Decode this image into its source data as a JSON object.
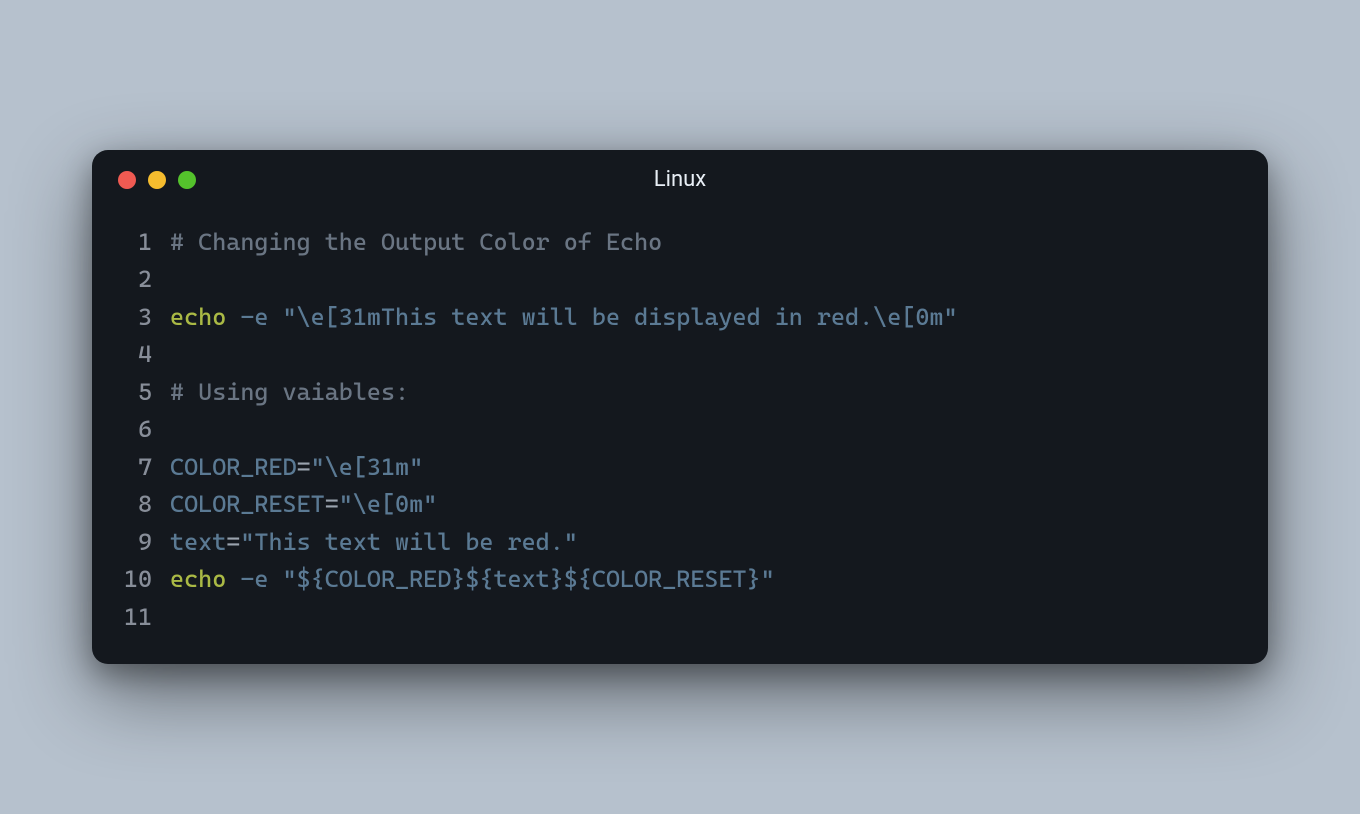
{
  "window": {
    "title": "Linux",
    "controls": {
      "close_color": "#ef5a52",
      "minimize_color": "#f5bc2e",
      "zoom_color": "#54c22c"
    }
  },
  "code": {
    "lines": [
      {
        "n": "1",
        "tokens": [
          {
            "cls": "tok-comment",
            "t": "# Changing the Output Color of Echo"
          }
        ]
      },
      {
        "n": "2",
        "tokens": []
      },
      {
        "n": "3",
        "tokens": [
          {
            "cls": "tok-builtin",
            "t": "echo"
          },
          {
            "cls": "",
            "t": " "
          },
          {
            "cls": "tok-flag",
            "t": "-e"
          },
          {
            "cls": "",
            "t": " "
          },
          {
            "cls": "tok-string",
            "t": "\"\\e[31mThis text will be displayed in red.\\e[0m\""
          }
        ]
      },
      {
        "n": "4",
        "tokens": []
      },
      {
        "n": "5",
        "tokens": [
          {
            "cls": "tok-comment",
            "t": "# Using vaiables:"
          }
        ]
      },
      {
        "n": "6",
        "tokens": []
      },
      {
        "n": "7",
        "tokens": [
          {
            "cls": "tok-var",
            "t": "COLOR_RED"
          },
          {
            "cls": "tok-op",
            "t": "="
          },
          {
            "cls": "tok-string",
            "t": "\"\\e[31m\""
          }
        ]
      },
      {
        "n": "8",
        "tokens": [
          {
            "cls": "tok-var",
            "t": "COLOR_RESET"
          },
          {
            "cls": "tok-op",
            "t": "="
          },
          {
            "cls": "tok-string",
            "t": "\"\\e[0m\""
          }
        ]
      },
      {
        "n": "9",
        "tokens": [
          {
            "cls": "tok-var",
            "t": "text"
          },
          {
            "cls": "tok-op",
            "t": "="
          },
          {
            "cls": "tok-string",
            "t": "\"This text will be red.\""
          }
        ]
      },
      {
        "n": "10",
        "tokens": [
          {
            "cls": "tok-builtin",
            "t": "echo"
          },
          {
            "cls": "",
            "t": " "
          },
          {
            "cls": "tok-flag",
            "t": "-e"
          },
          {
            "cls": "",
            "t": " "
          },
          {
            "cls": "tok-string",
            "t": "\""
          },
          {
            "cls": "tok-interp",
            "t": "${COLOR_RED}${text}${COLOR_RESET}"
          },
          {
            "cls": "tok-string",
            "t": "\""
          }
        ]
      },
      {
        "n": "11",
        "tokens": []
      }
    ]
  }
}
